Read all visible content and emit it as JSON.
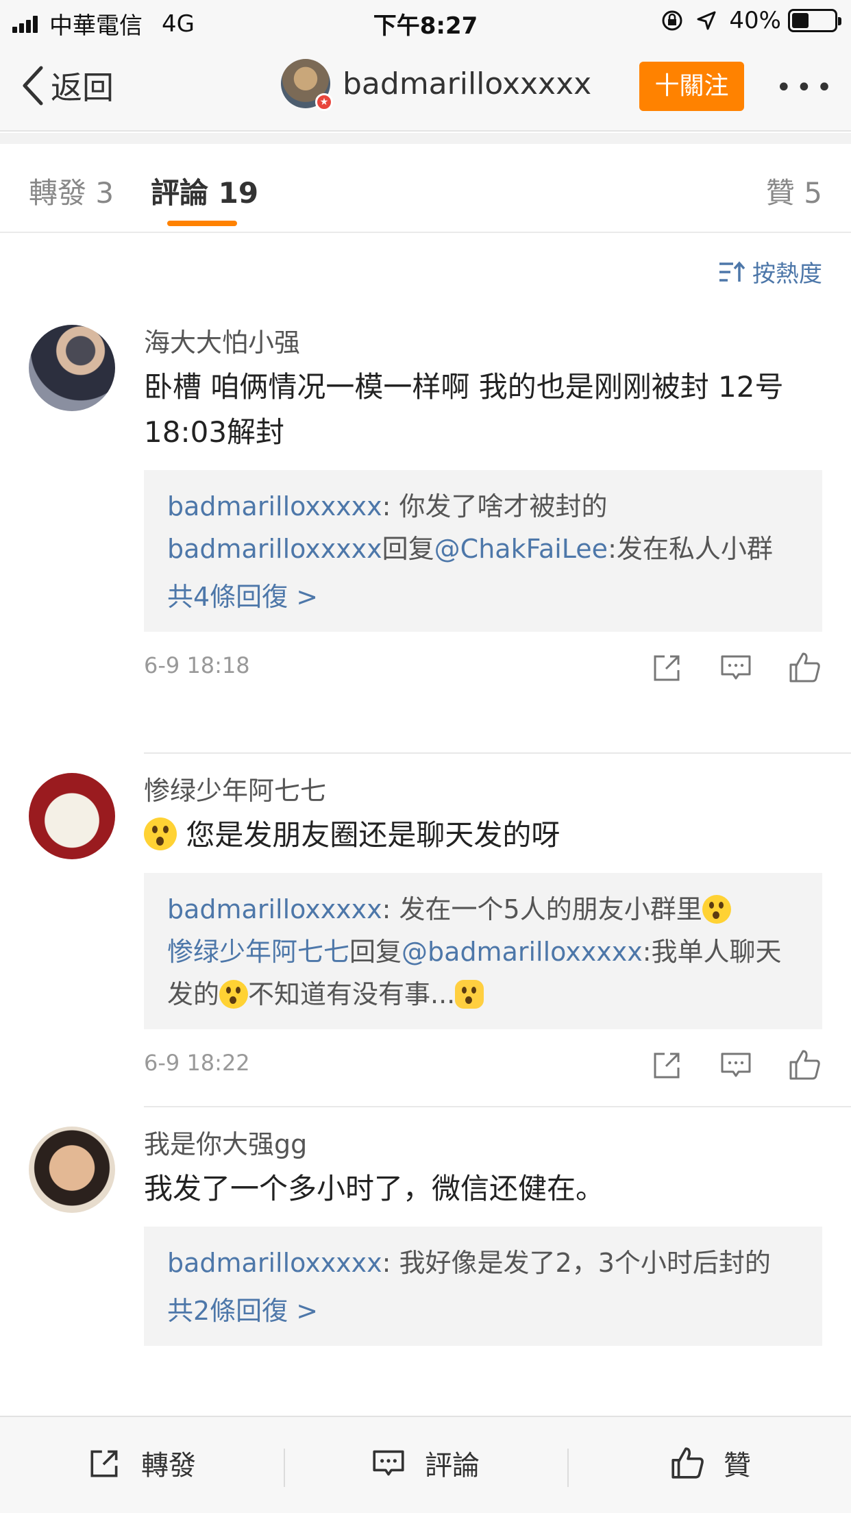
{
  "status_bar": {
    "carrier": "中華電信",
    "network": "4G",
    "time": "下午8:27",
    "battery": "40%",
    "battery_level": 0.4
  },
  "nav": {
    "back_label": "返回",
    "username": "badmarilloxxxxx",
    "follow_label": "十關注",
    "more_label": "•••"
  },
  "tabs": {
    "repost": "轉發 3",
    "comments": "評論 19",
    "likes": "贊 5"
  },
  "sort_label": "按熱度",
  "comments": [
    {
      "name": "海大大怕小强",
      "text": "卧槽 咱俩情况一模一样啊 我的也是刚刚被封  12号18:03解封",
      "replies": [
        {
          "author": "badmarilloxxxxx",
          "sep": ": ",
          "text": "你发了啥才被封的"
        },
        {
          "author": "badmarilloxxxxx",
          "reply_word": "回复",
          "mention": "@ChakFaiLee",
          "text": ":发在私人小群"
        }
      ],
      "more_replies": "共4條回復 >",
      "time": "6-9 18:18"
    },
    {
      "name": "惨绿少年阿七七",
      "text": "您是发朋友圈还是聊天发的呀",
      "replies": [
        {
          "author": "badmarilloxxxxx",
          "sep": ": ",
          "text": "发在一个5人的朋友小群里"
        },
        {
          "author": "惨绿少年阿七七",
          "reply_word": "回复",
          "mention": "@badmarilloxxxxx",
          "text_a": ":我单人聊天发的",
          "text_b": "不知道有没有事..."
        }
      ],
      "time": "6-9 18:22"
    },
    {
      "name": "我是你大强gg",
      "text": "我发了一个多小时了，微信还健在。",
      "replies": [
        {
          "author": "badmarilloxxxxx",
          "sep": ": ",
          "text": "我好像是发了2，3个小时后封的"
        }
      ],
      "more_replies": "共2條回復 >"
    }
  ],
  "bottom_bar": {
    "repost": "轉發",
    "comment": "評論",
    "like": "贊"
  },
  "colors": {
    "accent": "#ff8200",
    "link": "#4d77a9",
    "reply_bg": "#f3f3f3"
  }
}
